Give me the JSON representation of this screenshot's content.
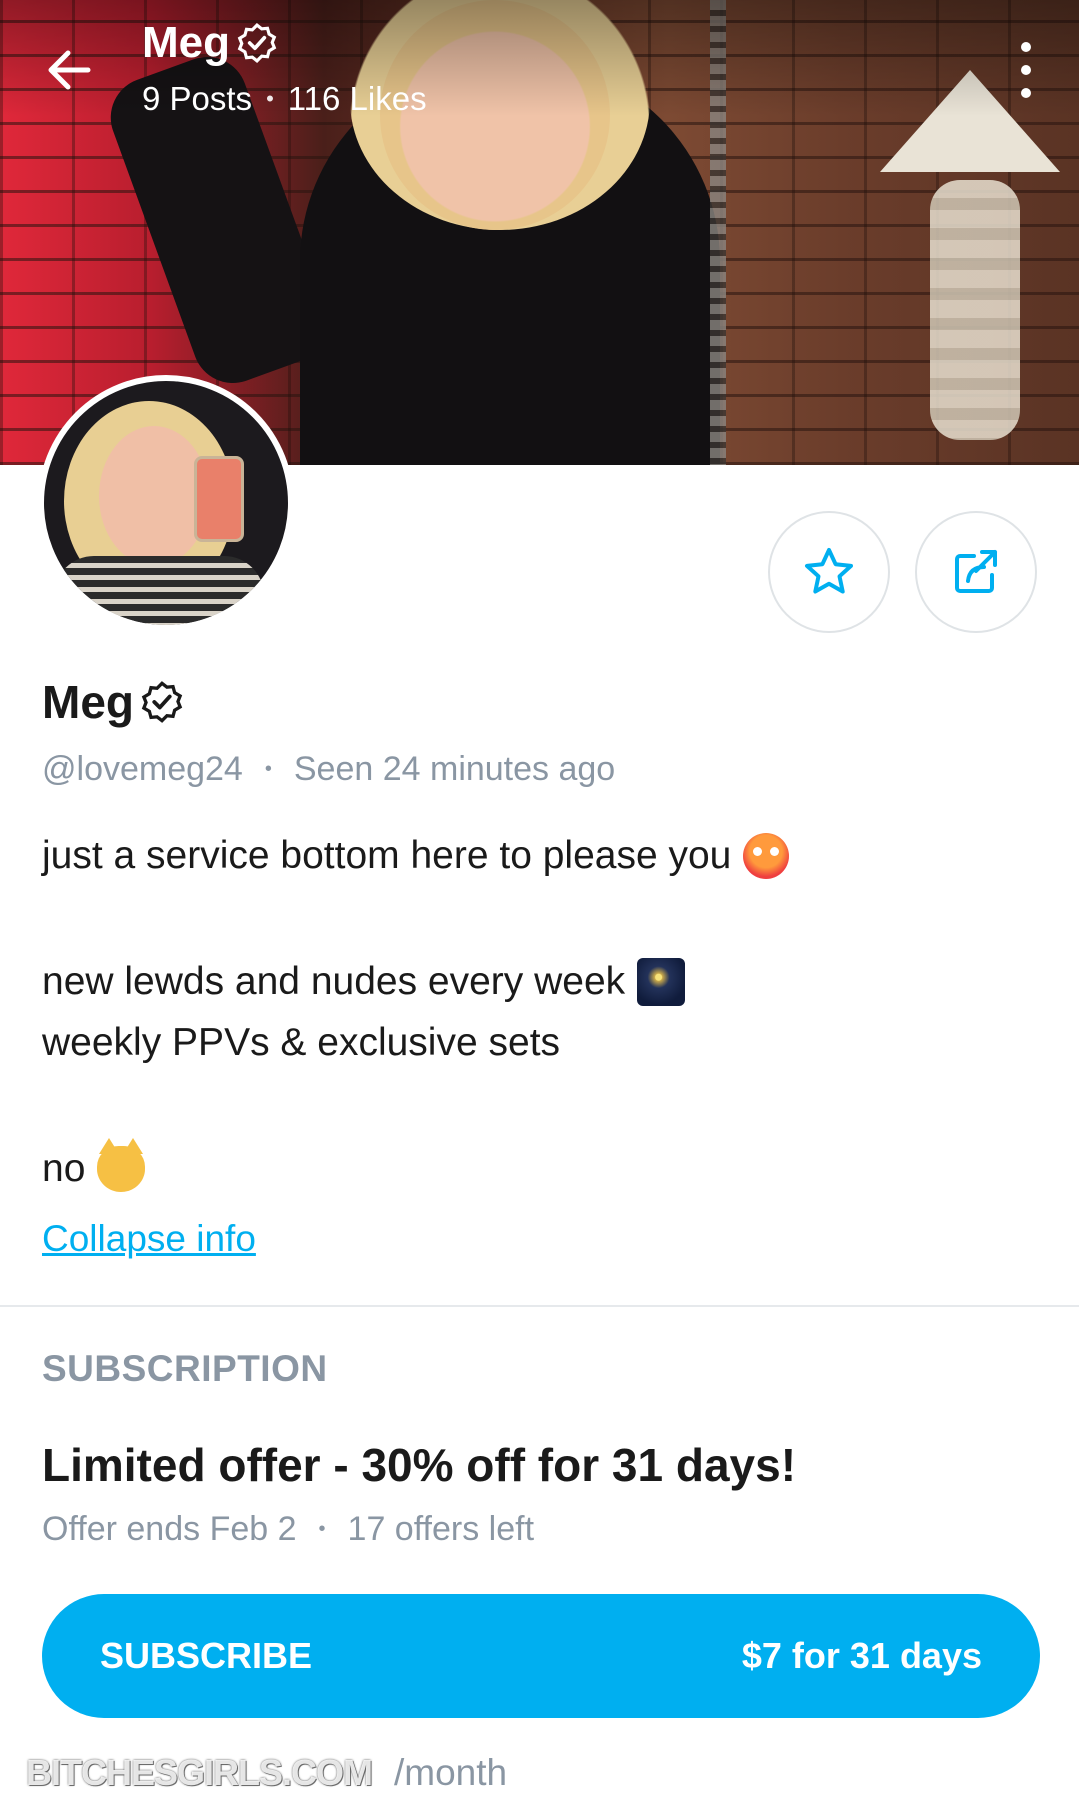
{
  "header": {
    "name": "Meg",
    "posts": "9 Posts",
    "likes": "116 Likes"
  },
  "profile": {
    "name": "Meg",
    "handle": "@lovemeg24",
    "seen": "Seen 24 minutes ago"
  },
  "bio": {
    "line1": "just a service bottom here to please you",
    "line2": "new lewds and nudes every week",
    "line3": "weekly PPVs & exclusive sets",
    "line4": "no"
  },
  "collapse_label": "Collapse info",
  "subscription": {
    "heading": "SUBSCRIPTION",
    "offer_title": "Limited offer - 30% off for 31 days!",
    "offer_ends": "Offer ends Feb 2",
    "offers_left": "17 offers left",
    "button_label": "SUBSCRIBE",
    "button_price": "$7 for 31 days",
    "regular_price_suffix": "/month"
  },
  "watermark": "BITCHESGIRLS.COM",
  "icons": {
    "back": "arrow-left-icon",
    "more": "more-vertical-icon",
    "verified": "verified-badge-icon",
    "favorite": "star-icon",
    "share": "share-icon"
  },
  "colors": {
    "accent": "#00aff0",
    "muted": "#8a96a3",
    "text": "#1a1a1a"
  }
}
